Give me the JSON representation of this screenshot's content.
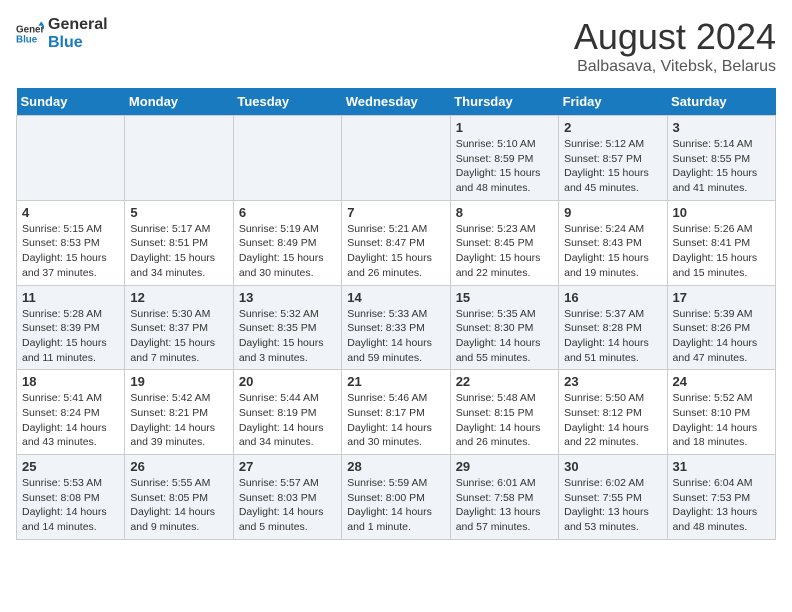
{
  "logo": {
    "line1": "General",
    "line2": "Blue"
  },
  "title": "August 2024",
  "subtitle": "Balbasava, Vitebsk, Belarus",
  "days_of_week": [
    "Sunday",
    "Monday",
    "Tuesday",
    "Wednesday",
    "Thursday",
    "Friday",
    "Saturday"
  ],
  "weeks": [
    [
      {
        "day": "",
        "info": ""
      },
      {
        "day": "",
        "info": ""
      },
      {
        "day": "",
        "info": ""
      },
      {
        "day": "",
        "info": ""
      },
      {
        "day": "1",
        "info": "Sunrise: 5:10 AM\nSunset: 8:59 PM\nDaylight: 15 hours\nand 48 minutes."
      },
      {
        "day": "2",
        "info": "Sunrise: 5:12 AM\nSunset: 8:57 PM\nDaylight: 15 hours\nand 45 minutes."
      },
      {
        "day": "3",
        "info": "Sunrise: 5:14 AM\nSunset: 8:55 PM\nDaylight: 15 hours\nand 41 minutes."
      }
    ],
    [
      {
        "day": "4",
        "info": "Sunrise: 5:15 AM\nSunset: 8:53 PM\nDaylight: 15 hours\nand 37 minutes."
      },
      {
        "day": "5",
        "info": "Sunrise: 5:17 AM\nSunset: 8:51 PM\nDaylight: 15 hours\nand 34 minutes."
      },
      {
        "day": "6",
        "info": "Sunrise: 5:19 AM\nSunset: 8:49 PM\nDaylight: 15 hours\nand 30 minutes."
      },
      {
        "day": "7",
        "info": "Sunrise: 5:21 AM\nSunset: 8:47 PM\nDaylight: 15 hours\nand 26 minutes."
      },
      {
        "day": "8",
        "info": "Sunrise: 5:23 AM\nSunset: 8:45 PM\nDaylight: 15 hours\nand 22 minutes."
      },
      {
        "day": "9",
        "info": "Sunrise: 5:24 AM\nSunset: 8:43 PM\nDaylight: 15 hours\nand 19 minutes."
      },
      {
        "day": "10",
        "info": "Sunrise: 5:26 AM\nSunset: 8:41 PM\nDaylight: 15 hours\nand 15 minutes."
      }
    ],
    [
      {
        "day": "11",
        "info": "Sunrise: 5:28 AM\nSunset: 8:39 PM\nDaylight: 15 hours\nand 11 minutes."
      },
      {
        "day": "12",
        "info": "Sunrise: 5:30 AM\nSunset: 8:37 PM\nDaylight: 15 hours\nand 7 minutes."
      },
      {
        "day": "13",
        "info": "Sunrise: 5:32 AM\nSunset: 8:35 PM\nDaylight: 15 hours\nand 3 minutes."
      },
      {
        "day": "14",
        "info": "Sunrise: 5:33 AM\nSunset: 8:33 PM\nDaylight: 14 hours\nand 59 minutes."
      },
      {
        "day": "15",
        "info": "Sunrise: 5:35 AM\nSunset: 8:30 PM\nDaylight: 14 hours\nand 55 minutes."
      },
      {
        "day": "16",
        "info": "Sunrise: 5:37 AM\nSunset: 8:28 PM\nDaylight: 14 hours\nand 51 minutes."
      },
      {
        "day": "17",
        "info": "Sunrise: 5:39 AM\nSunset: 8:26 PM\nDaylight: 14 hours\nand 47 minutes."
      }
    ],
    [
      {
        "day": "18",
        "info": "Sunrise: 5:41 AM\nSunset: 8:24 PM\nDaylight: 14 hours\nand 43 minutes."
      },
      {
        "day": "19",
        "info": "Sunrise: 5:42 AM\nSunset: 8:21 PM\nDaylight: 14 hours\nand 39 minutes."
      },
      {
        "day": "20",
        "info": "Sunrise: 5:44 AM\nSunset: 8:19 PM\nDaylight: 14 hours\nand 34 minutes."
      },
      {
        "day": "21",
        "info": "Sunrise: 5:46 AM\nSunset: 8:17 PM\nDaylight: 14 hours\nand 30 minutes."
      },
      {
        "day": "22",
        "info": "Sunrise: 5:48 AM\nSunset: 8:15 PM\nDaylight: 14 hours\nand 26 minutes."
      },
      {
        "day": "23",
        "info": "Sunrise: 5:50 AM\nSunset: 8:12 PM\nDaylight: 14 hours\nand 22 minutes."
      },
      {
        "day": "24",
        "info": "Sunrise: 5:52 AM\nSunset: 8:10 PM\nDaylight: 14 hours\nand 18 minutes."
      }
    ],
    [
      {
        "day": "25",
        "info": "Sunrise: 5:53 AM\nSunset: 8:08 PM\nDaylight: 14 hours\nand 14 minutes."
      },
      {
        "day": "26",
        "info": "Sunrise: 5:55 AM\nSunset: 8:05 PM\nDaylight: 14 hours\nand 9 minutes."
      },
      {
        "day": "27",
        "info": "Sunrise: 5:57 AM\nSunset: 8:03 PM\nDaylight: 14 hours\nand 5 minutes."
      },
      {
        "day": "28",
        "info": "Sunrise: 5:59 AM\nSunset: 8:00 PM\nDaylight: 14 hours\nand 1 minute."
      },
      {
        "day": "29",
        "info": "Sunrise: 6:01 AM\nSunset: 7:58 PM\nDaylight: 13 hours\nand 57 minutes."
      },
      {
        "day": "30",
        "info": "Sunrise: 6:02 AM\nSunset: 7:55 PM\nDaylight: 13 hours\nand 53 minutes."
      },
      {
        "day": "31",
        "info": "Sunrise: 6:04 AM\nSunset: 7:53 PM\nDaylight: 13 hours\nand 48 minutes."
      }
    ]
  ]
}
